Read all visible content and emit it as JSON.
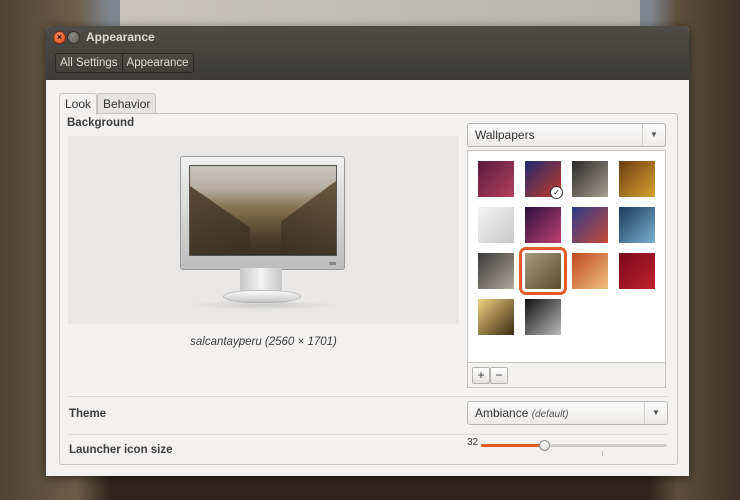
{
  "window": {
    "title": "Appearance",
    "breadcrumb": [
      "All Settings",
      "Appearance"
    ]
  },
  "tabs": [
    "Look",
    "Behavior"
  ],
  "background": {
    "section_label": "Background",
    "caption": "salcantayperu (2560 × 1701)",
    "source_select": "Wallpapers",
    "add_label": "+",
    "remove_label": "−",
    "wallpapers": [
      {
        "name": "purple-blur",
        "colors": [
          "#5a1a3a",
          "#b44060"
        ]
      },
      {
        "name": "turntable-blue",
        "colors": [
          "#1e2a6e",
          "#c43a2a"
        ],
        "checked": true
      },
      {
        "name": "train-station",
        "colors": [
          "#2a2a2a",
          "#a8a090"
        ]
      },
      {
        "name": "golden-light",
        "colors": [
          "#6a3e10",
          "#d8a030"
        ]
      },
      {
        "name": "white-shore",
        "colors": [
          "#f4f4f4",
          "#c8c8c8"
        ]
      },
      {
        "name": "purple-bokeh",
        "colors": [
          "#2a1040",
          "#c04070"
        ]
      },
      {
        "name": "turntable-red",
        "colors": [
          "#2a3a8a",
          "#c84a3a"
        ]
      },
      {
        "name": "blue-lake",
        "colors": [
          "#1a3a5a",
          "#7ab0d0"
        ]
      },
      {
        "name": "rocky-beach",
        "colors": [
          "#3a3a3a",
          "#b0a89a"
        ]
      },
      {
        "name": "salcantayperu",
        "colors": [
          "#a89a80",
          "#5a4a30"
        ],
        "selected": true
      },
      {
        "name": "orange-flare",
        "colors": [
          "#c04a20",
          "#f0c080"
        ]
      },
      {
        "name": "red-leaf",
        "colors": [
          "#7a0a1a",
          "#c02030"
        ]
      },
      {
        "name": "sunset-field",
        "colors": [
          "#f0d080",
          "#3a2a10"
        ]
      },
      {
        "name": "bw-building",
        "colors": [
          "#111111",
          "#bbbbbb"
        ]
      }
    ]
  },
  "theme": {
    "label": "Theme",
    "value": "Ambiance",
    "suffix": "(default)"
  },
  "launcher": {
    "label": "Launcher icon size",
    "value": "32",
    "fraction": 0.34
  },
  "colors": {
    "accent": "#e05a20",
    "titlebar": "#3c3b37"
  }
}
